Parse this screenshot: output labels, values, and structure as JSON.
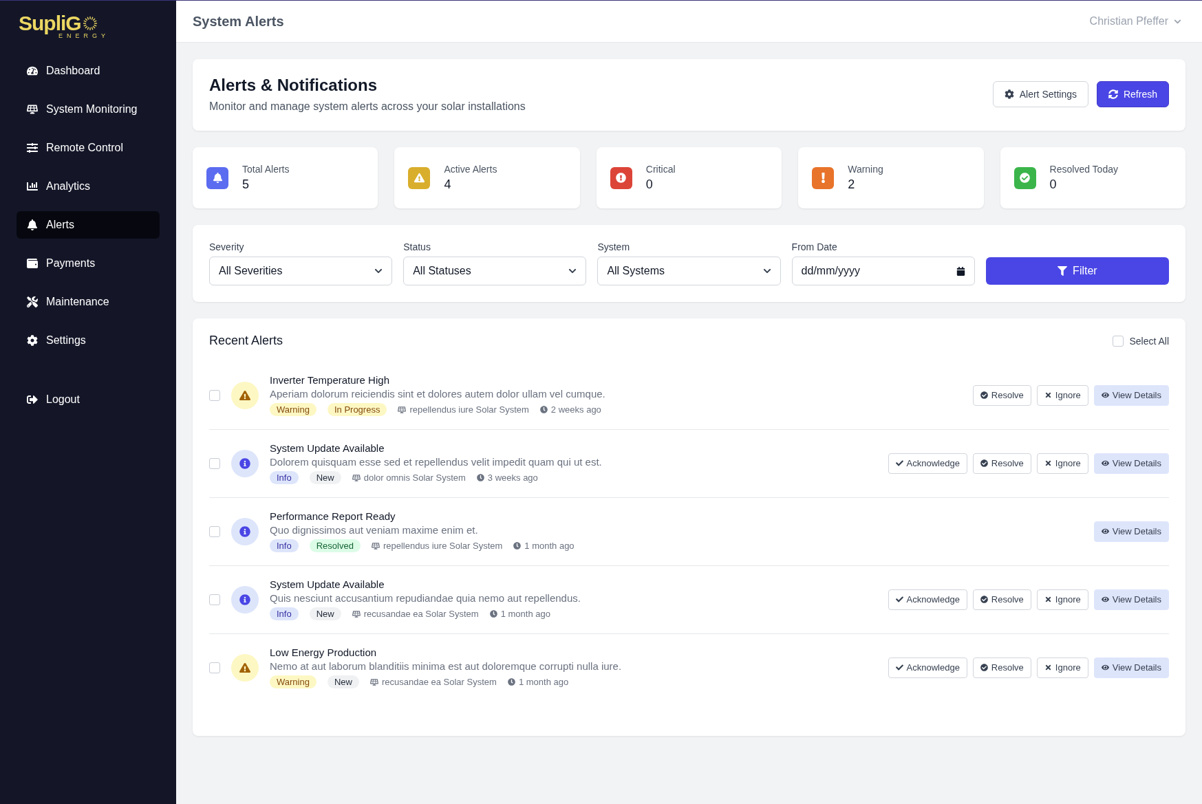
{
  "logo": {
    "text": "SupliG",
    "sub": "ENERGY"
  },
  "sidebar": {
    "items": [
      {
        "label": "Dashboard",
        "kind": "gauge",
        "selected": false
      },
      {
        "label": "System Monitoring",
        "kind": "solar",
        "selected": false
      },
      {
        "label": "Remote Control",
        "kind": "sliders",
        "selected": false
      },
      {
        "label": "Analytics",
        "kind": "chart",
        "selected": false
      },
      {
        "label": "Alerts",
        "kind": "bell",
        "selected": true
      },
      {
        "label": "Payments",
        "kind": "wallet",
        "selected": false
      },
      {
        "label": "Maintenance",
        "kind": "tools",
        "selected": false
      },
      {
        "label": "Settings",
        "kind": "gear",
        "selected": false
      }
    ],
    "logout": {
      "label": "Logout"
    }
  },
  "header": {
    "title": "System Alerts",
    "user": "Christian Pfeffer"
  },
  "page": {
    "title": "Alerts & Notifications",
    "subtitle": "Monitor and manage system alerts across your solar installations",
    "buttons": [
      {
        "label": "Alert Settings",
        "kind": "settings"
      },
      {
        "label": "Refresh",
        "kind": "refresh"
      }
    ]
  },
  "stats": [
    {
      "label": "Total Alerts",
      "value": "5",
      "kind": "bell",
      "color": "#5b6cf0"
    },
    {
      "label": "Active Alerts",
      "value": "4",
      "kind": "warning",
      "color": "#d9ae2c"
    },
    {
      "label": "Critical",
      "value": "0",
      "kind": "critical",
      "color": "#dc4438"
    },
    {
      "label": "Warning",
      "value": "2",
      "kind": "exclamation",
      "color": "#e8732a"
    },
    {
      "label": "Resolved Today",
      "value": "0",
      "kind": "check",
      "color": "#3bb54a"
    }
  ],
  "filters": {
    "fields": [
      {
        "label": "Severity",
        "value": "All Severities",
        "kind": "select"
      },
      {
        "label": "Status",
        "value": "All Statuses",
        "kind": "select"
      },
      {
        "label": "System",
        "value": "All Systems",
        "kind": "select"
      },
      {
        "label": "From Date",
        "value": "dd/mm/yyyy",
        "kind": "date"
      }
    ],
    "button": "Filter"
  },
  "alerts": {
    "title": "Recent Alerts",
    "select_all": {
      "label": "Select All",
      "checked": false
    },
    "items": [
      {
        "title": "Inverter Temperature High",
        "description": "Aperiam dolorum reiciendis sint et dolores autem dolor ullam vel cumque.",
        "severity": {
          "label": "Warning",
          "kind": "warning"
        },
        "status": {
          "label": "In Progress",
          "kind": "progress"
        },
        "system": "repellendus iure Solar System",
        "time": "2 weeks ago",
        "checked": false,
        "actions": [
          {
            "label": "Resolve",
            "kind": "resolve"
          },
          {
            "label": "Ignore",
            "kind": "ignore"
          },
          {
            "label": "View Details",
            "kind": "view"
          }
        ]
      },
      {
        "title": "System Update Available",
        "description": "Dolorem quisquam esse sed et repellendus velit impedit quam qui ut est.",
        "severity": {
          "label": "Info",
          "kind": "info"
        },
        "status": {
          "label": "New",
          "kind": "new"
        },
        "system": "dolor omnis Solar System",
        "time": "3 weeks ago",
        "checked": false,
        "actions": [
          {
            "label": "Acknowledge",
            "kind": "acknowledge"
          },
          {
            "label": "Resolve",
            "kind": "resolve"
          },
          {
            "label": "Ignore",
            "kind": "ignore"
          },
          {
            "label": "View Details",
            "kind": "view"
          }
        ]
      },
      {
        "title": "Performance Report Ready",
        "description": "Quo dignissimos aut veniam maxime enim et.",
        "severity": {
          "label": "Info",
          "kind": "info"
        },
        "status": {
          "label": "Resolved",
          "kind": "resolved"
        },
        "system": "repellendus iure Solar System",
        "time": "1 month ago",
        "checked": false,
        "actions": [
          {
            "label": "View Details",
            "kind": "view"
          }
        ]
      },
      {
        "title": "System Update Available",
        "description": "Quis nesciunt accusantium repudiandae quia nemo aut repellendus.",
        "severity": {
          "label": "Info",
          "kind": "info"
        },
        "status": {
          "label": "New",
          "kind": "new"
        },
        "system": "recusandae ea Solar System",
        "time": "1 month ago",
        "checked": false,
        "actions": [
          {
            "label": "Acknowledge",
            "kind": "acknowledge"
          },
          {
            "label": "Resolve",
            "kind": "resolve"
          },
          {
            "label": "Ignore",
            "kind": "ignore"
          },
          {
            "label": "View Details",
            "kind": "view"
          }
        ]
      },
      {
        "title": "Low Energy Production",
        "description": "Nemo at aut laborum blanditiis minima est aut doloremque corrupti nulla iure.",
        "severity": {
          "label": "Warning",
          "kind": "warning"
        },
        "status": {
          "label": "New",
          "kind": "new"
        },
        "system": "recusandae ea Solar System",
        "time": "1 month ago",
        "checked": false,
        "actions": [
          {
            "label": "Acknowledge",
            "kind": "acknowledge"
          },
          {
            "label": "Resolve",
            "kind": "resolve"
          },
          {
            "label": "Ignore",
            "kind": "ignore"
          },
          {
            "label": "View Details",
            "kind": "view"
          }
        ]
      }
    ]
  }
}
